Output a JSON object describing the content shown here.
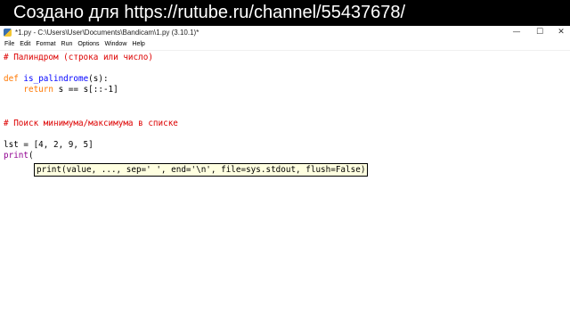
{
  "banner": {
    "text": "Создано для https://rutube.ru/channel/55437678/"
  },
  "window": {
    "title": "*1.py - C:\\Users\\User\\Documents\\Bandicam\\1.py (3.10.1)*",
    "controls": {
      "minimize": "—",
      "maximize": "☐",
      "close": "✕"
    }
  },
  "menu": [
    "File",
    "Edit",
    "Format",
    "Run",
    "Options",
    "Window",
    "Help"
  ],
  "code": {
    "line1_comment": "# Палиндром (строка или число)",
    "line2_kw": "def",
    "line2_fn": "is_palindrome",
    "line2_rest": "(s):",
    "line3_indent": "    ",
    "line3_kw": "return",
    "line3_rest": " s == s[::-1]",
    "line4_comment": "# Поиск минимума/максимума в списке",
    "line5": "lst = [4, 2, 9, 5]",
    "line6_builtin": "print",
    "line6_rest": "("
  },
  "calltip": {
    "text": "print(value, ..., sep=' ', end='\\n', file=sys.stdout, flush=False)"
  }
}
